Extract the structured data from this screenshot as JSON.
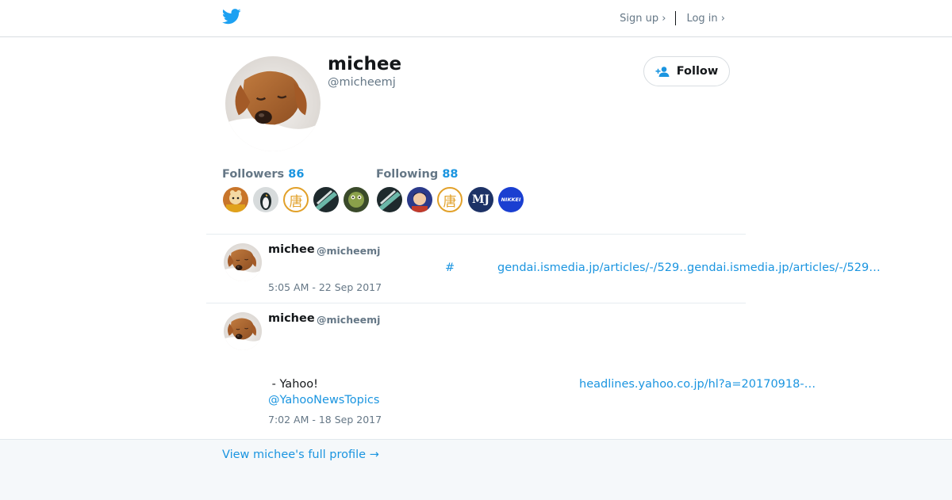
{
  "header": {
    "logo_icon": "twitter-bird-icon",
    "sign_up": "Sign up ›",
    "log_in": "Log in ›"
  },
  "profile": {
    "name": "michee",
    "handle": "@micheemj",
    "avatar_icon": "dog-avatar",
    "follow_label": "Follow",
    "followers_label": "Followers",
    "followers_count": "86",
    "following_label": "Following",
    "following_count": "88"
  },
  "followers_avatars": [
    {
      "icon": "avatar-rabbit",
      "text": ""
    },
    {
      "icon": "avatar-penguin",
      "text": ""
    },
    {
      "icon": "avatar-kanji",
      "text": "唐"
    },
    {
      "icon": "avatar-green-stripes",
      "text": ""
    },
    {
      "icon": "avatar-frog",
      "text": ""
    }
  ],
  "following_avatars": [
    {
      "icon": "avatar-green-stripes",
      "text": ""
    },
    {
      "icon": "avatar-anime",
      "text": ""
    },
    {
      "icon": "avatar-kanji",
      "text": "唐"
    },
    {
      "icon": "avatar-mj",
      "text": "MJ"
    },
    {
      "icon": "avatar-nikkei",
      "text": "NIKKEI"
    }
  ],
  "tweets": [
    {
      "name": "michee",
      "handle": "@micheemj",
      "hash": "#",
      "link1": "gendai.ismedia.jp/articles/-/529…",
      "link2": "gendai.ismedia.jp/articles/-/529…",
      "time": "5:05 AM - 22 Sep 2017"
    },
    {
      "name": "michee",
      "handle": "@micheemj",
      "text": " - Yahoo!",
      "link1": "headlines.yahoo.co.jp/hl?a=20170918-…",
      "mention": "@YahooNewsTopics",
      "time": "7:02 AM - 18 Sep 2017"
    }
  ],
  "footer": {
    "view_profile": "View michee's full profile →"
  },
  "colors": {
    "accent": "#1b95e0",
    "twitter_blue": "#1da1f2",
    "muted": "#657786",
    "text": "#14171a",
    "footer_bg": "#f5f8fa"
  }
}
